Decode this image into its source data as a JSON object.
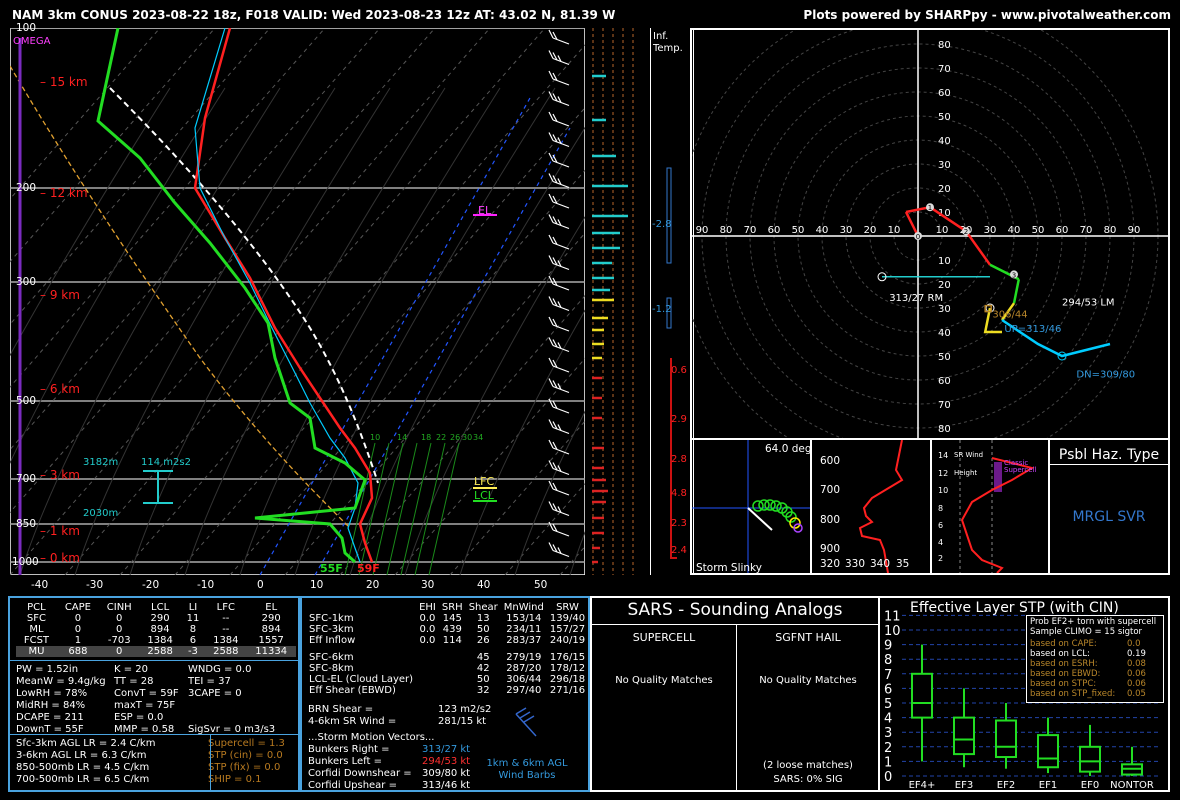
{
  "header": {
    "left": "NAM 3km CONUS 2023-08-22 18z, F018  VALID: Wed 2023-08-23 12z  AT: 43.02 N, 81.39 W",
    "right": "Plots powered by SHARPpy - www.pivotalweather.com"
  },
  "skewt": {
    "omega_label": "OMEGA",
    "pressure_labels": [
      "100",
      "200",
      "300",
      "500",
      "700",
      "850",
      "1000"
    ],
    "height_labels": [
      "15 km",
      "12 km",
      "9 km",
      "6 km",
      "3 km",
      "1 km",
      "0 km"
    ],
    "temp_ticks": [
      "-40",
      "-30",
      "-20",
      "-10",
      "0",
      "10",
      "20",
      "30",
      "40",
      "50"
    ],
    "mixing_ratio_labels": [
      "10",
      "14",
      "18",
      "22",
      "26",
      "30",
      "34"
    ],
    "el_label": "EL",
    "lfc_label": "LFC",
    "lcl_label": "LCL",
    "sfc_dewpoint": "55F",
    "sfc_temp": "59F",
    "eff_inflow_top": "3182m",
    "eff_inflow_srh": "114 m2s2",
    "eff_inflow_bottom": "2030m",
    "colors": {
      "temp": "#ff2020",
      "dewpoint": "#22dd22",
      "virtual_temp": "#ff2020",
      "wetbulb": "#00ccff",
      "parcel": "#ffffff",
      "dgz": "#ffaa00"
    }
  },
  "chart_data": [
    {
      "type": "line",
      "title": "Skew-T",
      "xlabel": "",
      "ylabel": "",
      "ylim": [
        1000,
        100
      ],
      "xlim": [
        -40,
        50
      ],
      "series": [
        {
          "name": "temperature_C",
          "x": [
            15,
            13,
            10,
            5,
            3,
            -5,
            -12,
            -24,
            -42,
            -55,
            -62
          ],
          "y": [
            1000,
            925,
            850,
            750,
            700,
            600,
            500,
            400,
            300,
            200,
            150
          ]
        },
        {
          "name": "dewpoint_C",
          "x": [
            12,
            10,
            2,
            -2,
            -4,
            -18,
            -28,
            -35,
            -50,
            -60,
            -80
          ],
          "y": [
            1000,
            925,
            850,
            750,
            700,
            600,
            500,
            400,
            300,
            200,
            150
          ]
        }
      ]
    },
    {
      "type": "line",
      "title": "Hodograph",
      "xlabel": "",
      "ylabel": "",
      "series": [
        {
          "name": "hodograph_kt",
          "x": [
            0,
            -5,
            5,
            20,
            30,
            42,
            40,
            35
          ],
          "y": [
            0,
            10,
            12,
            2,
            -12,
            -18,
            -28,
            -35
          ]
        }
      ],
      "markers": {
        "rm": "313/27 RM",
        "lm": "294/53 LM",
        "mean": "306/44",
        "up": "UP=313/46",
        "dn": "DN=309/80"
      }
    }
  ],
  "hodo": {
    "ring_labels_y": [
      "80",
      "70",
      "60",
      "50",
      "40",
      "30",
      "20",
      "10"
    ],
    "ring_labels_y_low": [
      "10",
      "20",
      "30",
      "40",
      "50",
      "60",
      "70",
      "80"
    ],
    "ring_labels_x": [
      "90",
      "80",
      "70",
      "60",
      "50",
      "40",
      "30",
      "20",
      "10",
      "",
      "10",
      "20",
      "30",
      "40",
      "50",
      "60",
      "70",
      "80",
      "90"
    ],
    "rm_label": "313/27 RM",
    "lm_label": "294/53 LM",
    "mean_label": "306/44",
    "up_label": "UP=313/46",
    "dn_label": "DN=309/80",
    "height_markers": [
      "0",
      "1",
      "2",
      "3"
    ]
  },
  "inferred": {
    "label1": "Inf.",
    "label2": "Temp.",
    "values_left": [
      "-2.8",
      "-1.2"
    ],
    "values_right": [
      "0.6",
      "2.9",
      "2.8",
      "4.8",
      "2.3",
      "2.4"
    ]
  },
  "slinky": {
    "title": "64.0 deg",
    "label": "Storm Slinky",
    "y_ticks": [
      "600",
      "700",
      "800",
      "900"
    ],
    "x_ticks": [
      "320",
      "330",
      "340",
      "35"
    ]
  },
  "srwind": {
    "title": "SR Wind",
    "height_label": "Height",
    "classic_label": "Classic Supercell",
    "y_ticks": [
      "14",
      "12",
      "10",
      "8",
      "6",
      "4",
      "2"
    ]
  },
  "haz": {
    "title": "Psbl Haz. Type",
    "value": "MRGL SVR"
  },
  "parcel_table": {
    "headers": [
      "PCL",
      "CAPE",
      "CINH",
      "LCL",
      "LI",
      "LFC",
      "EL"
    ],
    "rows": [
      [
        "SFC",
        "0",
        "0",
        "290",
        "11",
        "--",
        "290"
      ],
      [
        "ML",
        "0",
        "0",
        "894",
        "8",
        "--",
        "894"
      ],
      [
        "FCST",
        "1",
        "-703",
        "1384",
        "6",
        "1384",
        "1557"
      ],
      [
        "MU",
        "688",
        "0",
        "2588",
        "-3",
        "2588",
        "11334"
      ]
    ]
  },
  "indices": {
    "col1": [
      "PW = 1.52in",
      "MeanW = 9.4g/kg",
      "LowRH = 78%",
      "MidRH = 84%",
      "DCAPE = 211",
      "DownT = 55F"
    ],
    "col2": [
      "K = 20",
      "TT = 28",
      "ConvT = 59F",
      "maxT = 75F",
      "ESP = 0.0",
      "MMP = 0.58"
    ],
    "col3": [
      "WNDG = 0.0",
      "TEI = 37",
      "3CAPE = 0",
      "",
      "",
      "SigSvr = 0 m3/s3"
    ]
  },
  "lapse": [
    "Sfc-3km AGL LR = 2.4 C/km",
    "3-6km AGL LR = 6.3 C/km",
    "850-500mb LR = 4.5 C/km",
    "700-500mb LR = 6.5 C/km"
  ],
  "composite": [
    "Supercell = 1.3",
    "STP (cin) = 0.0",
    "STP (fix) = 0.0",
    "SHIP = 0.1"
  ],
  "kinematic": {
    "headers": [
      "EHI",
      "SRH",
      "Shear",
      "MnWind",
      "SRW"
    ],
    "rows": [
      [
        "SFC-1km",
        "0.0",
        "145",
        "13",
        "153/14",
        "139/40"
      ],
      [
        "SFC-3km",
        "0.0",
        "439",
        "50",
        "234/11",
        "157/27"
      ],
      [
        "Eff Inflow",
        "0.0",
        "114",
        "26",
        "283/37",
        "240/19"
      ],
      [
        "SFC-6km",
        "",
        "",
        "45",
        "279/19",
        "176/15"
      ],
      [
        "SFC-8km",
        "",
        "",
        "42",
        "287/20",
        "178/12"
      ],
      [
        "LCL-EL (Cloud Layer)",
        "",
        "",
        "50",
        "306/44",
        "296/18"
      ],
      [
        "Eff Shear (EBWD)",
        "",
        "",
        "32",
        "297/40",
        "271/16"
      ]
    ],
    "brn_shear": "BRN Shear =",
    "brn_shear_val": "123 m2/s2",
    "sr_wind": "4-6km SR Wind =",
    "sr_wind_val": "281/15 kt",
    "storm_motion_title": "...Storm Motion Vectors...",
    "bunkers_right": "Bunkers Right =",
    "bunkers_right_val": "313/27 kt",
    "bunkers_left": "Bunkers Left =",
    "bunkers_left_val": "294/53 kt",
    "corfidi_down": "Corfidi Downshear =",
    "corfidi_down_val": "309/80 kt",
    "corfidi_up": "Corfidi Upshear =",
    "corfidi_up_val": "313/46 kt",
    "barbs_label1": "1km & 6km AGL",
    "barbs_label2": "Wind Barbs"
  },
  "sars": {
    "title": "SARS - Sounding Analogs",
    "supercell": "SUPERCELL",
    "hail": "SGFNT HAIL",
    "no_match1": "No Quality Matches",
    "no_match2": "No Quality Matches",
    "loose": "(2 loose matches)",
    "sig": "SARS: 0% SIG"
  },
  "stp": {
    "title": "Effective Layer STP (with CIN)",
    "prob_title": "Prob EF2+ torn with supercell",
    "climo": "Sample CLIMO = 15 sigtor",
    "rows": [
      {
        "label": "based on CAPE:",
        "value": "0.0"
      },
      {
        "label": "based on LCL:",
        "value": "0.19"
      },
      {
        "label": "based on ESRH:",
        "value": "0.08"
      },
      {
        "label": "based on EBWD:",
        "value": "0.06"
      },
      {
        "label": "based on STPC:",
        "value": "0.06"
      },
      {
        "label": "based on STP_fixed:",
        "value": "0.05"
      }
    ],
    "y_ticks": [
      "11",
      "10",
      "9",
      "8",
      "7",
      "6",
      "5",
      "4",
      "3",
      "2",
      "1",
      "0"
    ],
    "categories": [
      "EF4+",
      "EF3",
      "EF2",
      "EF1",
      "EF0",
      "NONTOR"
    ]
  }
}
